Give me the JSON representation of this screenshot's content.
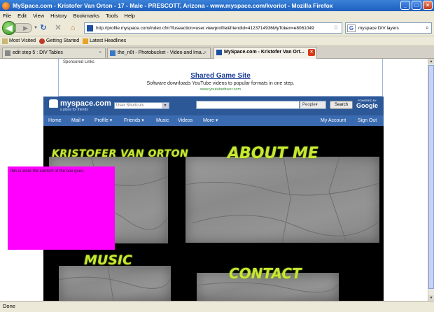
{
  "browser": {
    "title": "MySpace.com - Kristofer Van Orton - 17 - Male - PRESCOTT, Arizona - www.myspace.com/kvoriot - Mozilla Firefox",
    "menu": [
      "File",
      "Edit",
      "View",
      "History",
      "Bookmarks",
      "Tools",
      "Help"
    ],
    "url": "http://profile.myspace.com/index.cfm?fuseaction=user.viewprofile&friendid=4123714936MyToken=e8061049",
    "search": {
      "value": "myspace DIV layers",
      "engine_letter": "G"
    },
    "bookmarks": [
      "Most Visited",
      "Getting Started",
      "Latest Headlines"
    ],
    "tabs": [
      {
        "label": "edit step 5 : DIV Tables",
        "active": false
      },
      {
        "label": "the_n0t - Photobucket - Video and Ima...",
        "active": false
      },
      {
        "label": "MySpace.com - Kristofer Van Ort...",
        "active": true
      }
    ],
    "status": "Done",
    "window_buttons": [
      "_",
      "□",
      "×"
    ]
  },
  "ad": {
    "sponsored": "Sponsored Links",
    "title": "Shared Game Site",
    "desc": "Software downloads YouTube videos to popular formats in one step.",
    "url": "www.youtubedriver.com"
  },
  "myspace": {
    "logo": "myspace.com",
    "tagline": "a place for friends",
    "shortcuts_placeholder": "User Shortcuts",
    "people_label": "People",
    "search_button": "Search",
    "powered_by": "POWERED BY",
    "google": "Google",
    "nav_left": [
      "Home",
      "Mail ▾",
      "Profile ▾",
      "Friends ▾",
      "Music",
      "Videos",
      "More ▾"
    ],
    "nav_right": [
      "My Account",
      "Sign Out"
    ]
  },
  "profile": {
    "name_heading": "KRISTOFER VAN ORTON",
    "about_heading": "ABOUT ME",
    "music_heading": "MUSIC",
    "contact_heading": "CONTACT",
    "box_text": "this is were the content of the box goes."
  },
  "colors": {
    "pink_box": "#ff00ff",
    "graffiti": "#c6e832",
    "myspace_blue": "#2c5898"
  }
}
